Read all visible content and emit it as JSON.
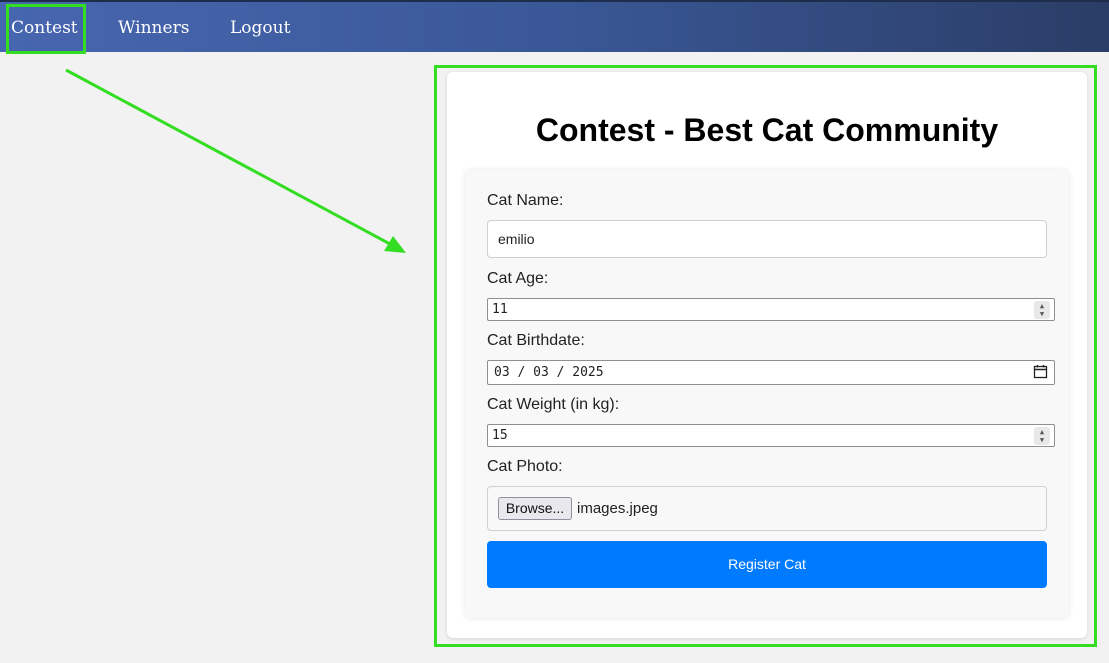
{
  "nav": {
    "items": [
      {
        "label": "Contest"
      },
      {
        "label": "Winners"
      },
      {
        "label": "Logout"
      }
    ]
  },
  "page": {
    "title": "Contest - Best Cat Community"
  },
  "form": {
    "name_label": "Cat Name:",
    "name_value": "emilio",
    "age_label": "Cat Age:",
    "age_value": "11",
    "birthdate_label": "Cat Birthdate:",
    "birthdate_value": "03 / 03 / 2025",
    "weight_label": "Cat Weight (in kg):",
    "weight_value": "15",
    "photo_label": "Cat Photo:",
    "browse_label": "Browse...",
    "photo_filename": "images.jpeg",
    "submit_label": "Register Cat"
  },
  "colors": {
    "highlight": "#33dd22",
    "primary_button": "#007bff",
    "navbar_start": "#4766b0",
    "navbar_end": "#2a3d66"
  },
  "icons": {
    "arrow": "arrow-annotation-icon",
    "calendar": "calendar-icon",
    "spinner": "spinner-arrows-icon"
  }
}
